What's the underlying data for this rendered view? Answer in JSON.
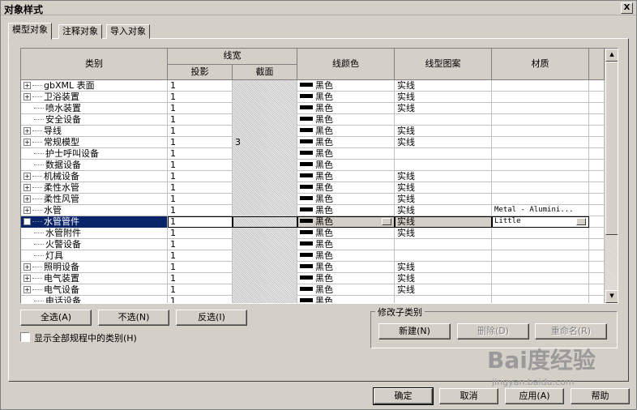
{
  "window": {
    "title": "对象样式",
    "close_label": "X"
  },
  "tabs": [
    {
      "label": "模型对象",
      "active": true
    },
    {
      "label": "注释对象",
      "active": false
    },
    {
      "label": "导入对象",
      "active": false
    }
  ],
  "table": {
    "headers": {
      "category": "类别",
      "line_weight": "线宽",
      "projection": "投影",
      "cut": "截面",
      "line_color": "线颜色",
      "line_pattern": "线型图案",
      "material": "材质"
    },
    "rows": [
      {
        "expander": "+",
        "category": "gbXML 表面",
        "projection": "1",
        "cut": "",
        "color": "黑色",
        "pattern": "实线",
        "material": ""
      },
      {
        "expander": "+",
        "category": "卫浴装置",
        "projection": "1",
        "cut": "",
        "color": "黑色",
        "pattern": "实线",
        "material": ""
      },
      {
        "expander": "",
        "category": "喷水装置",
        "projection": "1",
        "cut": "",
        "color": "黑色",
        "pattern": "实线",
        "material": ""
      },
      {
        "expander": "",
        "category": "安全设备",
        "projection": "1",
        "cut": "",
        "color": "黑色",
        "pattern": "",
        "material": ""
      },
      {
        "expander": "+",
        "category": "导线",
        "projection": "1",
        "cut": "",
        "color": "黑色",
        "pattern": "实线",
        "material": ""
      },
      {
        "expander": "+",
        "category": "常规模型",
        "projection": "1",
        "cut": "3",
        "color": "黑色",
        "pattern": "实线",
        "material": ""
      },
      {
        "expander": "",
        "category": "护士呼叫设备",
        "projection": "1",
        "cut": "",
        "color": "黑色",
        "pattern": "",
        "material": ""
      },
      {
        "expander": "",
        "category": "数据设备",
        "projection": "1",
        "cut": "",
        "color": "黑色",
        "pattern": "",
        "material": ""
      },
      {
        "expander": "+",
        "category": "机械设备",
        "projection": "1",
        "cut": "",
        "color": "黑色",
        "pattern": "实线",
        "material": ""
      },
      {
        "expander": "+",
        "category": "柔性水管",
        "projection": "1",
        "cut": "",
        "color": "黑色",
        "pattern": "实线",
        "material": ""
      },
      {
        "expander": "+",
        "category": "柔性风管",
        "projection": "1",
        "cut": "",
        "color": "黑色",
        "pattern": "实线",
        "material": ""
      },
      {
        "expander": "+",
        "category": "水管",
        "projection": "1",
        "cut": "",
        "color": "黑色",
        "pattern": "实线",
        "material": "Metal - Alumini..."
      },
      {
        "expander": "+",
        "category": "水管管件",
        "projection": "1",
        "cut": "",
        "color": "黑色",
        "pattern": "实线",
        "material": "Little",
        "selected": true
      },
      {
        "expander": "",
        "category": "水管附件",
        "projection": "1",
        "cut": "",
        "color": "黑色",
        "pattern": "实线",
        "material": ""
      },
      {
        "expander": "",
        "category": "火警设备",
        "projection": "1",
        "cut": "",
        "color": "黑色",
        "pattern": "",
        "material": ""
      },
      {
        "expander": "",
        "category": "灯具",
        "projection": "1",
        "cut": "",
        "color": "黑色",
        "pattern": "",
        "material": ""
      },
      {
        "expander": "+",
        "category": "照明设备",
        "projection": "1",
        "cut": "",
        "color": "黑色",
        "pattern": "实线",
        "material": ""
      },
      {
        "expander": "+",
        "category": "电气装置",
        "projection": "1",
        "cut": "",
        "color": "黑色",
        "pattern": "实线",
        "material": ""
      },
      {
        "expander": "+",
        "category": "电气设备",
        "projection": "1",
        "cut": "",
        "color": "黑色",
        "pattern": "实线",
        "material": ""
      },
      {
        "expander": "",
        "category": "电话设备",
        "projection": "1",
        "cut": "",
        "color": "黑色",
        "pattern": "",
        "material": ""
      }
    ]
  },
  "buttons": {
    "select_all": "全选(A)",
    "select_none": "不选(N)",
    "invert": "反选(I)",
    "ok": "确定",
    "cancel": "取消",
    "apply": "应用(A)",
    "help": "帮助"
  },
  "subcategory": {
    "group_title": "修改子类别",
    "new": "新建(N)",
    "delete": "删除(D)",
    "rename": "重命名(R)"
  },
  "show_all_checkbox": {
    "label": "显示全部规程中的类别(H)",
    "checked": false
  },
  "watermark": {
    "logo": "Bai度经验",
    "url": "jingyan.baidu.com"
  }
}
